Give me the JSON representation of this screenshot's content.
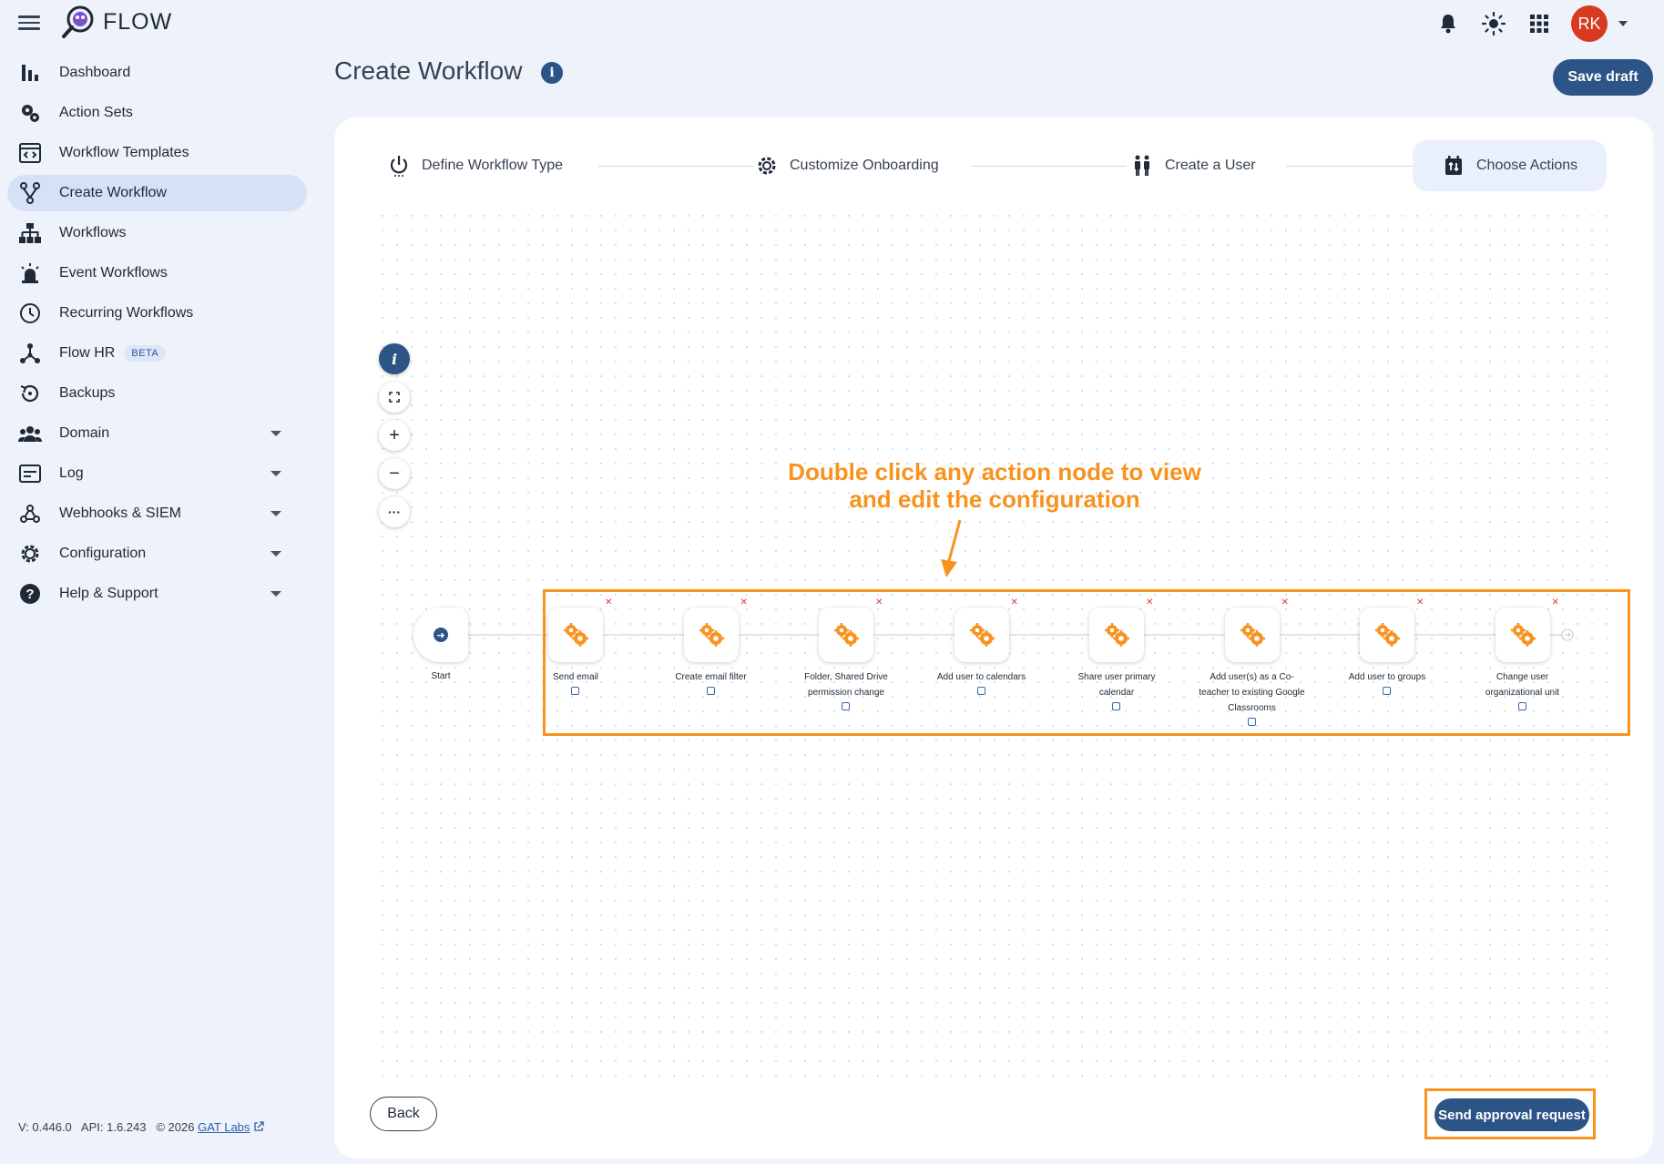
{
  "app": {
    "brand": "FLOW"
  },
  "user": {
    "initials": "RK"
  },
  "sidebar": {
    "items": [
      {
        "label": "Dashboard"
      },
      {
        "label": "Action Sets"
      },
      {
        "label": "Workflow Templates"
      },
      {
        "label": "Create Workflow"
      },
      {
        "label": "Workflows"
      },
      {
        "label": "Event Workflows"
      },
      {
        "label": "Recurring Workflows"
      },
      {
        "label": "Flow HR",
        "badge": "BETA"
      },
      {
        "label": "Backups"
      },
      {
        "label": "Domain"
      },
      {
        "label": "Log"
      },
      {
        "label": "Webhooks & SIEM"
      },
      {
        "label": "Configuration"
      },
      {
        "label": "Help & Support"
      }
    ]
  },
  "footer": {
    "version": "V: 0.446.0",
    "api": "API: 1.6.243",
    "copyright": "© 2026",
    "company": "GAT Labs"
  },
  "header": {
    "title": "Create Workflow",
    "info": "i",
    "save_label": "Save draft"
  },
  "stepper": {
    "steps": [
      {
        "label": "Define Workflow Type"
      },
      {
        "label": "Customize Onboarding"
      },
      {
        "label": "Create a User"
      },
      {
        "label": "Choose Actions"
      }
    ]
  },
  "canvas": {
    "info": "i",
    "zoom_in": "+",
    "zoom_out": "−",
    "more": "···",
    "annotation_line1": "Double click any action node to view",
    "annotation_line2": "and edit the configuration",
    "start_label": "Start",
    "nodes": [
      {
        "label": "Send email"
      },
      {
        "label": "Create email filter"
      },
      {
        "label": "Folder, Shared Drive permission change"
      },
      {
        "label": "Add user to calendars"
      },
      {
        "label": "Share user primary calendar"
      },
      {
        "label": "Add user(s) as a Co-teacher to existing Google Classrooms"
      },
      {
        "label": "Add user to groups"
      },
      {
        "label": "Change user organizational unit"
      }
    ]
  },
  "actions": {
    "back_label": "Back",
    "send_label": "Send approval request"
  },
  "colors": {
    "primary": "#2d5486",
    "accent": "#f7931e",
    "avatar": "#d9391f"
  }
}
